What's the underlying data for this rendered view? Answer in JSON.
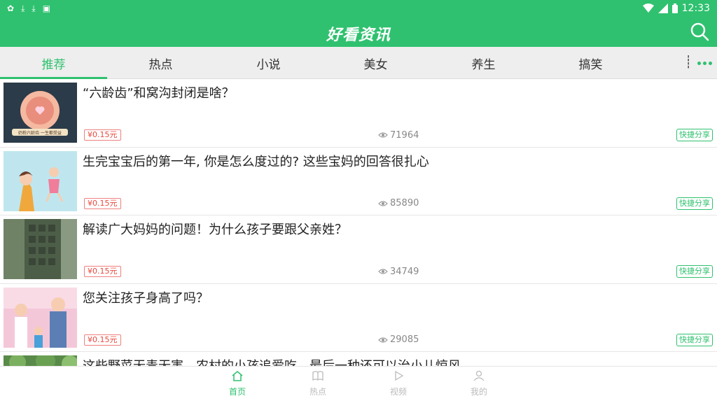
{
  "status_bar": {
    "time": "12:33"
  },
  "header": {
    "title": "好看资讯"
  },
  "tabs": [
    {
      "label": "推荐",
      "active": true
    },
    {
      "label": "热点",
      "active": false
    },
    {
      "label": "小说",
      "active": false
    },
    {
      "label": "美女",
      "active": false
    },
    {
      "label": "养生",
      "active": false
    },
    {
      "label": "搞笑",
      "active": false
    }
  ],
  "articles": [
    {
      "title": "“六龄齿”和窝沟封闭是啥？",
      "price": "¥0.15元",
      "views": "71964",
      "share": "快捷分享",
      "thumb_caption": "奶粉六龄齿 一生都受益"
    },
    {
      "title": "生完宝宝后的第一年, 你是怎么度过的? 这些宝妈的回答很扎心",
      "price": "¥0.15元",
      "views": "85890",
      "share": "快捷分享"
    },
    {
      "title": "解读广大妈妈的问题！为什么孩子要跟父亲姓？",
      "price": "¥0.15元",
      "views": "34749",
      "share": "快捷分享"
    },
    {
      "title": "您关注孩子身高了吗？",
      "price": "¥0.15元",
      "views": "29085",
      "share": "快捷分享"
    },
    {
      "title": "这些野菜无毒无害，农村的小孩追爱吃，最后一种还可以治小儿惊风",
      "price": "",
      "views": "",
      "share": ""
    }
  ],
  "bottom_nav": [
    {
      "label": "首页",
      "icon": "home-icon",
      "active": true
    },
    {
      "label": "热点",
      "icon": "book-icon",
      "active": false
    },
    {
      "label": "视频",
      "icon": "play-icon",
      "active": false
    },
    {
      "label": "我的",
      "icon": "user-icon",
      "active": false
    }
  ],
  "colors": {
    "accent": "#2fc16f",
    "price": "#e8483d"
  }
}
